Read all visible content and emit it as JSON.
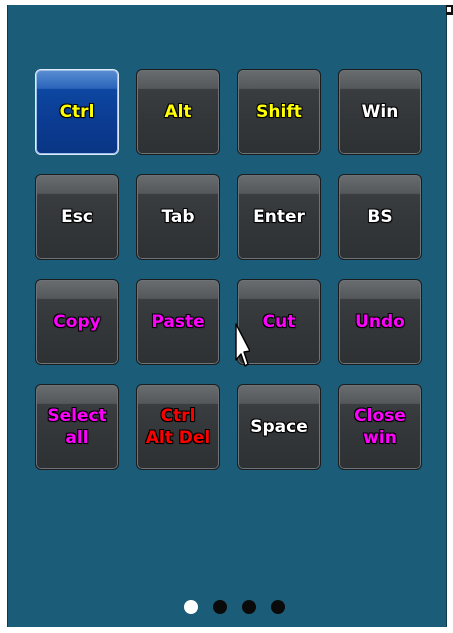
{
  "keys": [
    {
      "label": "Ctrl",
      "color": "#ffff00",
      "selected": true
    },
    {
      "label": "Alt",
      "color": "#ffff00",
      "selected": false
    },
    {
      "label": "Shift",
      "color": "#ffff00",
      "selected": false
    },
    {
      "label": "Win",
      "color": "#ffffff",
      "selected": false
    },
    {
      "label": "Esc",
      "color": "#ffffff",
      "selected": false
    },
    {
      "label": "Tab",
      "color": "#ffffff",
      "selected": false
    },
    {
      "label": "Enter",
      "color": "#ffffff",
      "selected": false
    },
    {
      "label": "BS",
      "color": "#ffffff",
      "selected": false
    },
    {
      "label": "Copy",
      "color": "#ff00ff",
      "selected": false
    },
    {
      "label": "Paste",
      "color": "#ff00ff",
      "selected": false
    },
    {
      "label": "Cut",
      "color": "#ff00ff",
      "selected": false
    },
    {
      "label": "Undo",
      "color": "#ff00ff",
      "selected": false
    },
    {
      "label": "Select\nall",
      "color": "#ff00ff",
      "selected": false
    },
    {
      "label": "Ctrl\nAlt Del",
      "color": "#ff0000",
      "selected": false
    },
    {
      "label": "Space",
      "color": "#ffffff",
      "selected": false
    },
    {
      "label": "Close\nwin",
      "color": "#ff00ff",
      "selected": false
    }
  ],
  "pager": {
    "pages": 4,
    "active_index": 0
  },
  "colors": {
    "background": "#1b5c78",
    "key_face": "#333638",
    "key_selected": "#0d47a1"
  }
}
